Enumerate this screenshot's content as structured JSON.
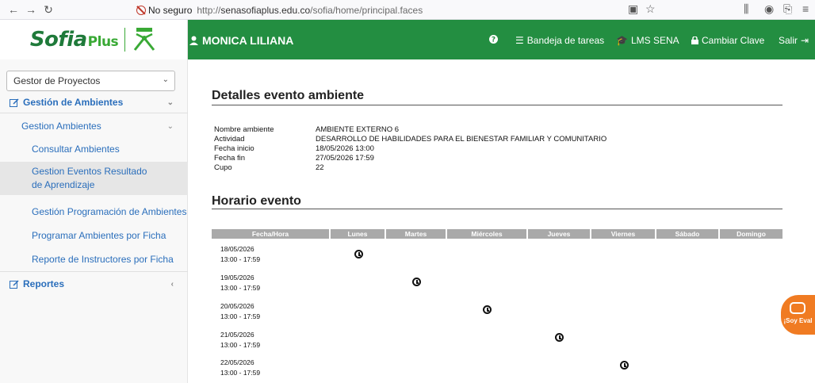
{
  "browser": {
    "insecure_label": "No seguro",
    "url_prefix": "http://",
    "url_host": "senasofiaplus.edu.co",
    "url_path": "/sofia/home/principal.faces"
  },
  "app": {
    "logo_main": "Sofia",
    "logo_plus": "Plus",
    "user_name": "MONICA LILIANA",
    "nav": {
      "help_icon": "question-circle-icon",
      "bandeja": "Bandeja de tareas",
      "lms": "LMS SENA",
      "cambiar": "Cambiar Clave",
      "salir": "Salir"
    },
    "brand_color": "#238e41"
  },
  "sidebar": {
    "project_selected": "Gestor de Proyectos",
    "section_ambientes": "Gestión de Ambientes",
    "sub_gestion": "Gestion Ambientes",
    "items": [
      "Consultar Ambientes",
      "Gestion Eventos Resultado de Aprendizaje",
      "Gestión Programación de Ambientes",
      "Programar Ambientes por Ficha",
      "Reporte de Instructores por Ficha"
    ],
    "section_reportes": "Reportes"
  },
  "main": {
    "details_title": "Detalles evento ambiente",
    "details": {
      "ambiente_label": "Nombre ambiente",
      "ambiente_value": "AMBIENTE EXTERNO 6",
      "actividad_label": "Actividad",
      "actividad_value": "DESARROLLO DE HABILIDADES PARA EL BIENESTAR FAMILIAR Y COMUNITARIO",
      "inicio_label": "Fecha inicio",
      "inicio_value": "18/05/2026 13:00",
      "fin_label": "Fecha fin",
      "fin_value": "27/05/2026 17:59",
      "cupo_label": "Cupo",
      "cupo_value": "22"
    },
    "schedule_title": "Horario evento",
    "schedule_headers": [
      "Fecha/Hora",
      "Lunes",
      "Martes",
      "Miércoles",
      "Jueves",
      "Viernes",
      "Sábado",
      "Domingo"
    ],
    "schedule_rows": [
      {
        "date": "18/05/2026",
        "time": "13:00 - 17:59",
        "day": "Lunes"
      },
      {
        "date": "19/05/2026",
        "time": "13:00 - 17:59",
        "day": "Martes"
      },
      {
        "date": "20/05/2026",
        "time": "13:00 - 17:59",
        "day": "Miércoles"
      },
      {
        "date": "21/05/2026",
        "time": "13:00 - 17:59",
        "day": "Jueves"
      },
      {
        "date": "22/05/2026",
        "time": "13:00 - 17:59",
        "day": "Viernes"
      }
    ]
  },
  "eval_badge": "¡Soy Eval"
}
